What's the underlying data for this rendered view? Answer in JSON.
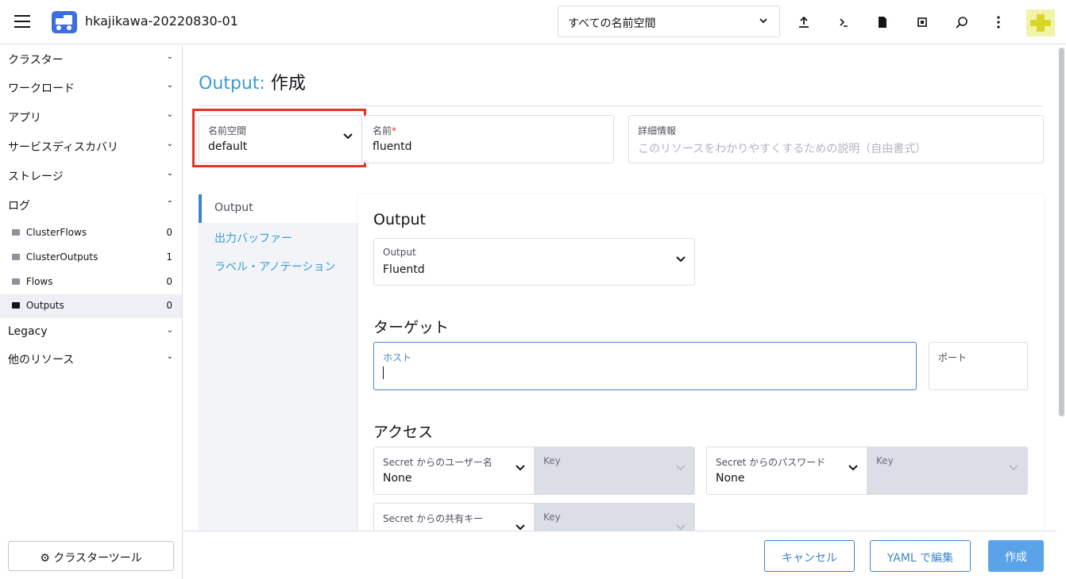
{
  "header": {
    "cluster_name": "hkajikawa-20220830-01",
    "namespace_filter": "すべての名前空間",
    "icons": [
      "upload-icon",
      "terminal-icon",
      "file-icon",
      "copy-icon",
      "search-icon",
      "more-icon"
    ]
  },
  "sidebar": {
    "groups": [
      {
        "label": "クラスター",
        "expanded": false
      },
      {
        "label": "ワークロード",
        "expanded": false
      },
      {
        "label": "アプリ",
        "expanded": false
      },
      {
        "label": "サービスディスカバリ",
        "expanded": false
      },
      {
        "label": "ストレージ",
        "expanded": false
      },
      {
        "label": "ログ",
        "expanded": true
      }
    ],
    "log_items": [
      {
        "label": "ClusterFlows",
        "count": "0"
      },
      {
        "label": "ClusterOutputs",
        "count": "1"
      },
      {
        "label": "Flows",
        "count": "0"
      },
      {
        "label": "Outputs",
        "count": "0"
      }
    ],
    "groups_after": [
      {
        "label": "Legacy"
      },
      {
        "label": "他のリソース"
      }
    ],
    "tools_button": "クラスターツール"
  },
  "page": {
    "title_kind": "Output:",
    "title_action": "作成",
    "namespace": {
      "label": "名前空間",
      "value": "default"
    },
    "name": {
      "label": "名前",
      "required_mark": "*",
      "value": "fluentd"
    },
    "description": {
      "label": "詳細情報",
      "placeholder": "このリソースをわかりやすくするための説明（自由書式）"
    }
  },
  "tabs": [
    {
      "label": "Output",
      "active": true
    },
    {
      "label": "出力バッファー",
      "active": false
    },
    {
      "label": "ラベル・アノテーション",
      "active": false
    }
  ],
  "output_section": {
    "heading": "Output",
    "select_label": "Output",
    "select_value": "Fluentd"
  },
  "target_section": {
    "heading": "ターゲット",
    "host_label": "ホスト",
    "port_label": "ポート"
  },
  "access_section": {
    "heading": "アクセス",
    "username_label": "Secret からのユーザー名",
    "username_value": "None",
    "key_label": "Key",
    "password_label": "Secret からのパスワード",
    "password_value": "None",
    "shared_key_label": "Secret からの共有キー"
  },
  "footer": {
    "cancel": "キャンセル",
    "edit_yaml": "YAML で編集",
    "create": "作成"
  },
  "colors": {
    "accent": "#3a9bd5",
    "highlight_box": "#e53424",
    "primary_button": "#5ba3e8"
  }
}
